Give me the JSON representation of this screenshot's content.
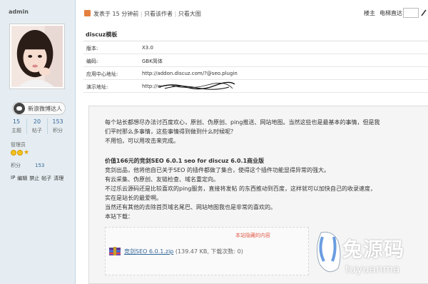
{
  "author": {
    "name": "admin",
    "weibo_button": "新浪微博达人",
    "stats": [
      {
        "value": "15",
        "label": "主题"
      },
      {
        "value": "20",
        "label": "帖子"
      },
      {
        "value": "153",
        "label": "积分"
      }
    ],
    "group": "管理员",
    "points_label": "积分",
    "points_value": "153",
    "admin_links": [
      "IP",
      "编辑",
      "禁止",
      "帖子",
      "清理"
    ]
  },
  "post_header": {
    "posted_text": "发表于 15 分钟前",
    "only_author": "只看该作者",
    "large_image": "只看大图",
    "floor_label": "楼主",
    "jump_label": "电梯直达"
  },
  "info_table": {
    "title": "discuz模板",
    "rows": [
      {
        "key": "版本:",
        "value": "X3.0"
      },
      {
        "key": "编码:",
        "value": "GBK简体"
      },
      {
        "key": "应用中心地址:",
        "value": "http://addon.discuz.com/?@seo.plugin"
      },
      {
        "key": "演示地址:",
        "value": "http://w"
      }
    ]
  },
  "content": {
    "para1_line1": "每个站长都想尽办法讨百度欢心，原创、伪原创、ping推送、网站地图。当然这些也是最基本的事情，但是我",
    "para1_line2": "们平时那么多事情，这些事情得到做到什么时候呢？",
    "para1_line3": "不用怕，可以用攻击来完成。",
    "title": "价值166元的竞剑SEO 6.0.1 seo for discuz 6.0.1商业版",
    "lines": [
      "竞剑出品，他将他自已关于SEO 的插件都做了集合，使得这个插件功能显得异常的强大。",
      "有云采集、伪原创、友链检查、域名重定向。",
      "不过乐云源码还是比较喜欢的ping服务，直接将发帖 的东西推动到百度，这样就可以加快自己的收录速度，",
      "实在是站长的最爱啊。",
      "当然还有其他的去除首页域名尾巴、网站地图我也是非常的喜欢的。",
      "本站下载："
    ],
    "hidden_label": "本站隐藏的内容",
    "attachment_name": "竞剑SEO 6.0.1.zip",
    "attachment_meta": "(139.47 KB, 下载次数: 0)"
  },
  "watermark": {
    "text": "兔源码",
    "sub": "tuyuanma"
  },
  "colors": {
    "sidebar_bg": "#e5edf2",
    "link": "#336699",
    "hidden_label": "#e25a47"
  }
}
